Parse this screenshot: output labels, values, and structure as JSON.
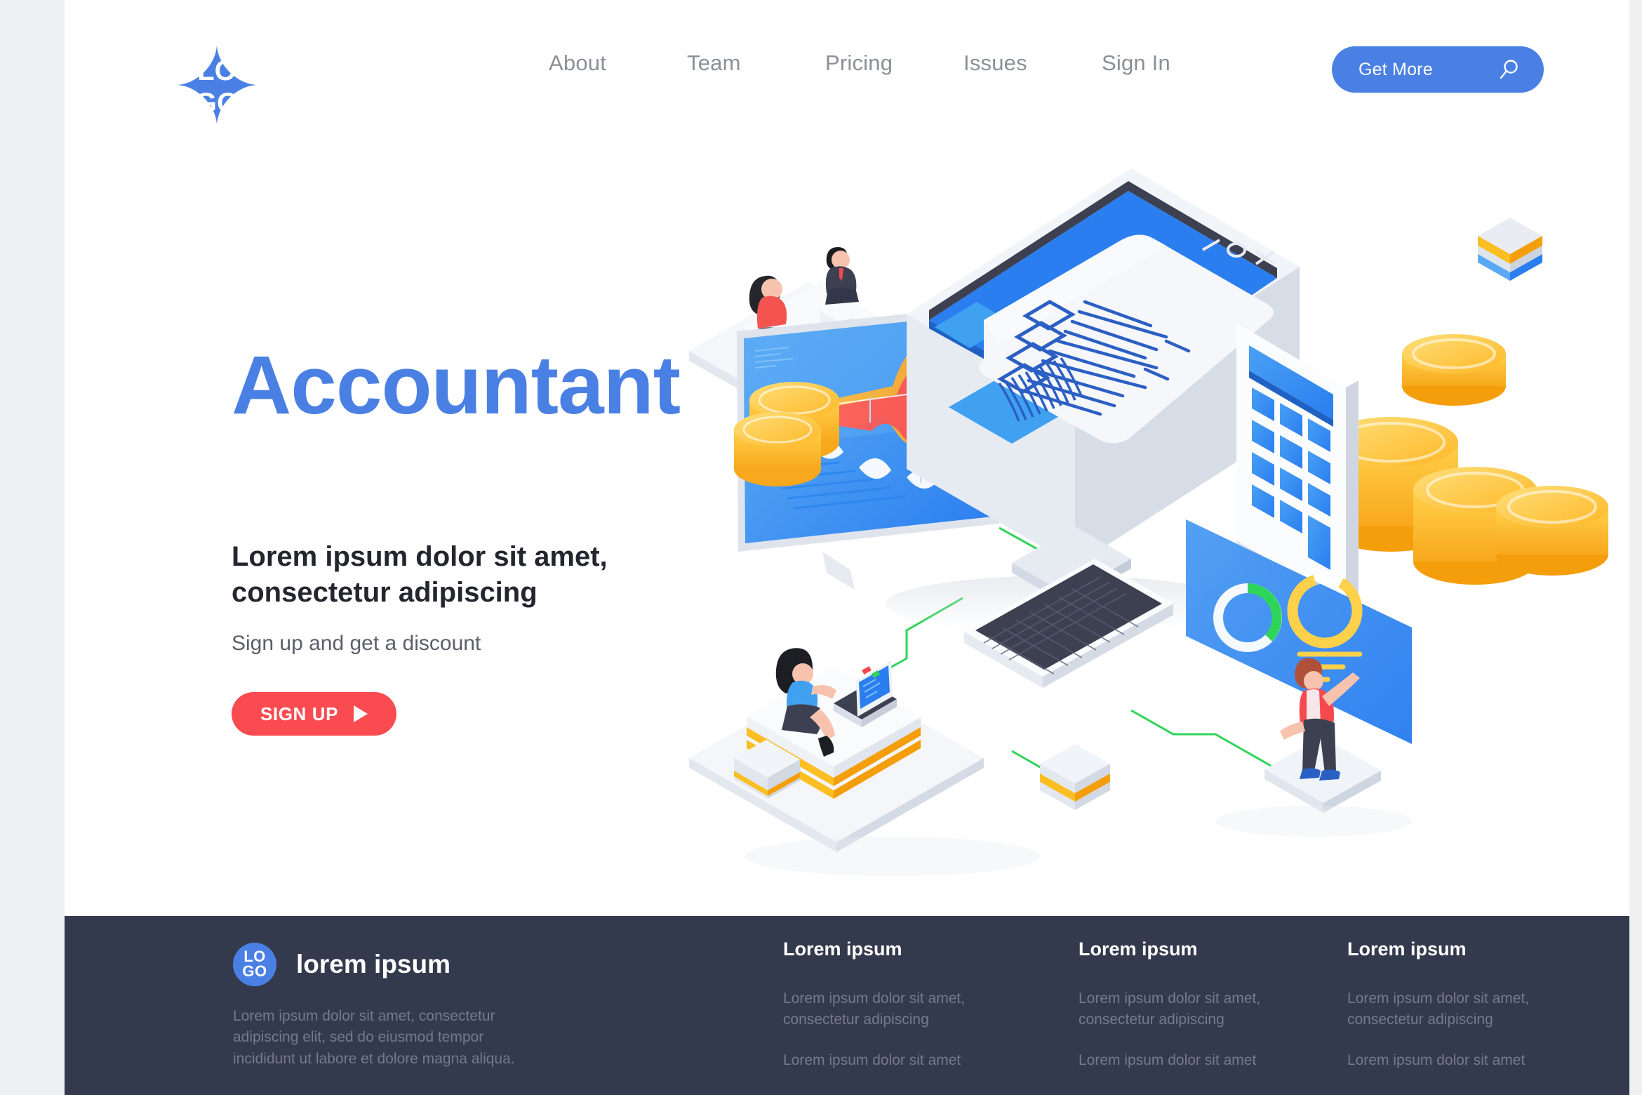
{
  "brand": {
    "logo_top": "LO",
    "logo_bottom": "GO",
    "accent_blue": "#4a80e4",
    "accent_red": "#fa4b50",
    "footer_bg": "#343a4d"
  },
  "header": {
    "nav": [
      {
        "label": "About"
      },
      {
        "label": "Team"
      },
      {
        "label": "Pricing"
      },
      {
        "label": "Issues"
      },
      {
        "label": "Sign In"
      }
    ],
    "cta": {
      "label": "Get More",
      "icon": "search-icon"
    }
  },
  "hero": {
    "title": "Accountant",
    "subtitle": "Lorem ipsum dolor sit amet, consectetur adipiscing",
    "tagline": "Sign up and get a discount",
    "button": {
      "label": "SIGN UP",
      "icon": "play-icon"
    }
  },
  "illustration": {
    "window_controls": "— O X",
    "alt": "isometric accounting scene: monitor with invoice, calculator, coin stacks, chart screen, keyboard, people at desks"
  },
  "footer": {
    "brand_name": "lorem ipsum",
    "description": "Lorem ipsum dolor sit amet, consectetur adipiscing elit, sed do eiusmod tempor incididunt ut labore et dolore magna aliqua.",
    "columns": [
      {
        "heading": "Lorem ipsum",
        "links": [
          "Lorem ipsum dolor sit amet, consectetur adipiscing",
          "Lorem ipsum dolor sit amet"
        ]
      },
      {
        "heading": "Lorem ipsum",
        "links": [
          "Lorem ipsum dolor sit amet, consectetur adipiscing",
          "Lorem ipsum dolor sit amet"
        ]
      },
      {
        "heading": "Lorem ipsum",
        "links": [
          "Lorem ipsum dolor sit amet, consectetur adipiscing",
          "Lorem ipsum dolor sit amet"
        ]
      }
    ]
  }
}
